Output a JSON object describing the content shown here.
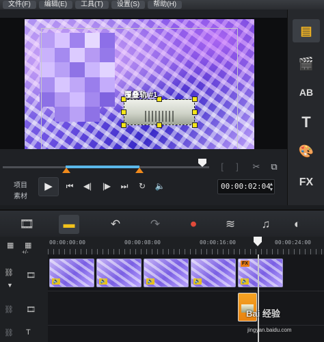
{
  "menu": {
    "items": [
      "文件(F)",
      "编辑(E)",
      "工具(T)",
      "设置(S)",
      "帮助(H)"
    ]
  },
  "preview": {
    "overlay_label": "覆叠轨 #1"
  },
  "controls": {
    "mode_project": "项目",
    "mode_clip": "素材",
    "timecode": "00:00:02:04"
  },
  "side_panel": {
    "items": [
      "media-library-icon",
      "instant-project-icon",
      "transition-icon",
      "title-icon",
      "graphics-icon",
      "filter-icon"
    ],
    "transition_label": "AB",
    "title_label": "T",
    "filter_label": "FX"
  },
  "timeline": {
    "ruler": [
      "00:00:00:00",
      "00:00:08:00",
      "00:00:16:00",
      "00:00:24:00"
    ],
    "fx_badge": "FX",
    "zoom_label": "+/-"
  },
  "watermark": {
    "brand": "Bai 经验",
    "url": "jingyan.baidu.com"
  },
  "colors": {
    "accent_orange": "#f08a1c",
    "trim_blue": "#5bb8ea",
    "handle_yellow": "#f4e51a"
  }
}
